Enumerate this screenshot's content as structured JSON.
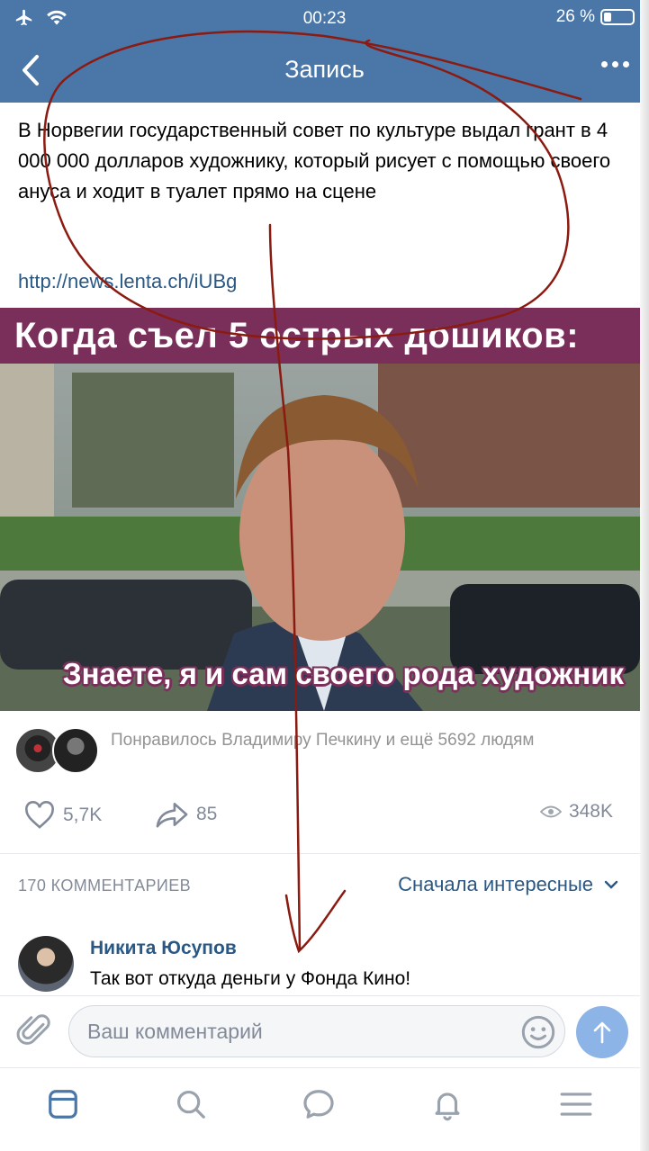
{
  "status_bar": {
    "time": "00:23",
    "battery": "26 %",
    "battery_level": 0.26
  },
  "nav": {
    "title": "Запись"
  },
  "post": {
    "text": "В Норвегии государственный совет по культуре выдал грант в 4 000 000 долларов художнику, который рисует с помощью своего ануса и ходит в туалет прямо на сцене",
    "link": "http://news.lenta.ch/iUBg",
    "meme_top": "Когда съел 5 острых дошиков:",
    "meme_bottom": "Знаете, я и сам своего рода художник",
    "liked_by": "Понравилось Владимиру Печкину и ещё 5692 людям",
    "likes": "5,7K",
    "shares": "85",
    "views": "348K"
  },
  "comments": {
    "count_label": "170 КОММЕНТАРИЕВ",
    "sort_label": "Сначала интересные",
    "items": [
      {
        "author": "Никита Юсупов",
        "text": "Так вот откуда деньги у Фонда Кино!"
      }
    ]
  },
  "composer": {
    "placeholder": "Ваш комментарий"
  },
  "colors": {
    "header": "#4a76a8",
    "link": "#2a5885",
    "meme_band": "#7a2f5a",
    "annotation": "#8b1a10"
  }
}
